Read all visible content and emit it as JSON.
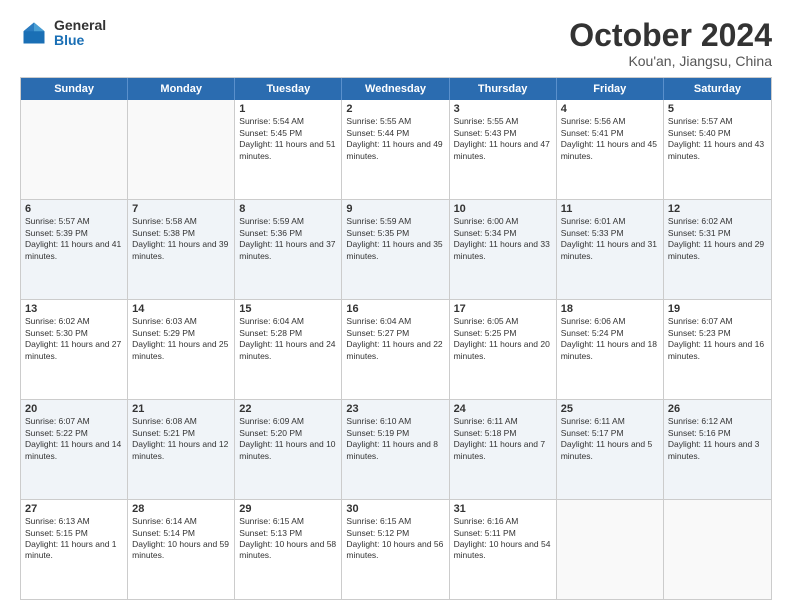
{
  "header": {
    "logo_general": "General",
    "logo_blue": "Blue",
    "month_title": "October 2024",
    "location": "Kou'an, Jiangsu, China"
  },
  "calendar": {
    "days_of_week": [
      "Sunday",
      "Monday",
      "Tuesday",
      "Wednesday",
      "Thursday",
      "Friday",
      "Saturday"
    ],
    "rows": [
      [
        {
          "day": "",
          "text": ""
        },
        {
          "day": "",
          "text": ""
        },
        {
          "day": "1",
          "text": "Sunrise: 5:54 AM\nSunset: 5:45 PM\nDaylight: 11 hours and 51 minutes."
        },
        {
          "day": "2",
          "text": "Sunrise: 5:55 AM\nSunset: 5:44 PM\nDaylight: 11 hours and 49 minutes."
        },
        {
          "day": "3",
          "text": "Sunrise: 5:55 AM\nSunset: 5:43 PM\nDaylight: 11 hours and 47 minutes."
        },
        {
          "day": "4",
          "text": "Sunrise: 5:56 AM\nSunset: 5:41 PM\nDaylight: 11 hours and 45 minutes."
        },
        {
          "day": "5",
          "text": "Sunrise: 5:57 AM\nSunset: 5:40 PM\nDaylight: 11 hours and 43 minutes."
        }
      ],
      [
        {
          "day": "6",
          "text": "Sunrise: 5:57 AM\nSunset: 5:39 PM\nDaylight: 11 hours and 41 minutes."
        },
        {
          "day": "7",
          "text": "Sunrise: 5:58 AM\nSunset: 5:38 PM\nDaylight: 11 hours and 39 minutes."
        },
        {
          "day": "8",
          "text": "Sunrise: 5:59 AM\nSunset: 5:36 PM\nDaylight: 11 hours and 37 minutes."
        },
        {
          "day": "9",
          "text": "Sunrise: 5:59 AM\nSunset: 5:35 PM\nDaylight: 11 hours and 35 minutes."
        },
        {
          "day": "10",
          "text": "Sunrise: 6:00 AM\nSunset: 5:34 PM\nDaylight: 11 hours and 33 minutes."
        },
        {
          "day": "11",
          "text": "Sunrise: 6:01 AM\nSunset: 5:33 PM\nDaylight: 11 hours and 31 minutes."
        },
        {
          "day": "12",
          "text": "Sunrise: 6:02 AM\nSunset: 5:31 PM\nDaylight: 11 hours and 29 minutes."
        }
      ],
      [
        {
          "day": "13",
          "text": "Sunrise: 6:02 AM\nSunset: 5:30 PM\nDaylight: 11 hours and 27 minutes."
        },
        {
          "day": "14",
          "text": "Sunrise: 6:03 AM\nSunset: 5:29 PM\nDaylight: 11 hours and 25 minutes."
        },
        {
          "day": "15",
          "text": "Sunrise: 6:04 AM\nSunset: 5:28 PM\nDaylight: 11 hours and 24 minutes."
        },
        {
          "day": "16",
          "text": "Sunrise: 6:04 AM\nSunset: 5:27 PM\nDaylight: 11 hours and 22 minutes."
        },
        {
          "day": "17",
          "text": "Sunrise: 6:05 AM\nSunset: 5:25 PM\nDaylight: 11 hours and 20 minutes."
        },
        {
          "day": "18",
          "text": "Sunrise: 6:06 AM\nSunset: 5:24 PM\nDaylight: 11 hours and 18 minutes."
        },
        {
          "day": "19",
          "text": "Sunrise: 6:07 AM\nSunset: 5:23 PM\nDaylight: 11 hours and 16 minutes."
        }
      ],
      [
        {
          "day": "20",
          "text": "Sunrise: 6:07 AM\nSunset: 5:22 PM\nDaylight: 11 hours and 14 minutes."
        },
        {
          "day": "21",
          "text": "Sunrise: 6:08 AM\nSunset: 5:21 PM\nDaylight: 11 hours and 12 minutes."
        },
        {
          "day": "22",
          "text": "Sunrise: 6:09 AM\nSunset: 5:20 PM\nDaylight: 11 hours and 10 minutes."
        },
        {
          "day": "23",
          "text": "Sunrise: 6:10 AM\nSunset: 5:19 PM\nDaylight: 11 hours and 8 minutes."
        },
        {
          "day": "24",
          "text": "Sunrise: 6:11 AM\nSunset: 5:18 PM\nDaylight: 11 hours and 7 minutes."
        },
        {
          "day": "25",
          "text": "Sunrise: 6:11 AM\nSunset: 5:17 PM\nDaylight: 11 hours and 5 minutes."
        },
        {
          "day": "26",
          "text": "Sunrise: 6:12 AM\nSunset: 5:16 PM\nDaylight: 11 hours and 3 minutes."
        }
      ],
      [
        {
          "day": "27",
          "text": "Sunrise: 6:13 AM\nSunset: 5:15 PM\nDaylight: 11 hours and 1 minute."
        },
        {
          "day": "28",
          "text": "Sunrise: 6:14 AM\nSunset: 5:14 PM\nDaylight: 10 hours and 59 minutes."
        },
        {
          "day": "29",
          "text": "Sunrise: 6:15 AM\nSunset: 5:13 PM\nDaylight: 10 hours and 58 minutes."
        },
        {
          "day": "30",
          "text": "Sunrise: 6:15 AM\nSunset: 5:12 PM\nDaylight: 10 hours and 56 minutes."
        },
        {
          "day": "31",
          "text": "Sunrise: 6:16 AM\nSunset: 5:11 PM\nDaylight: 10 hours and 54 minutes."
        },
        {
          "day": "",
          "text": ""
        },
        {
          "day": "",
          "text": ""
        }
      ]
    ]
  }
}
